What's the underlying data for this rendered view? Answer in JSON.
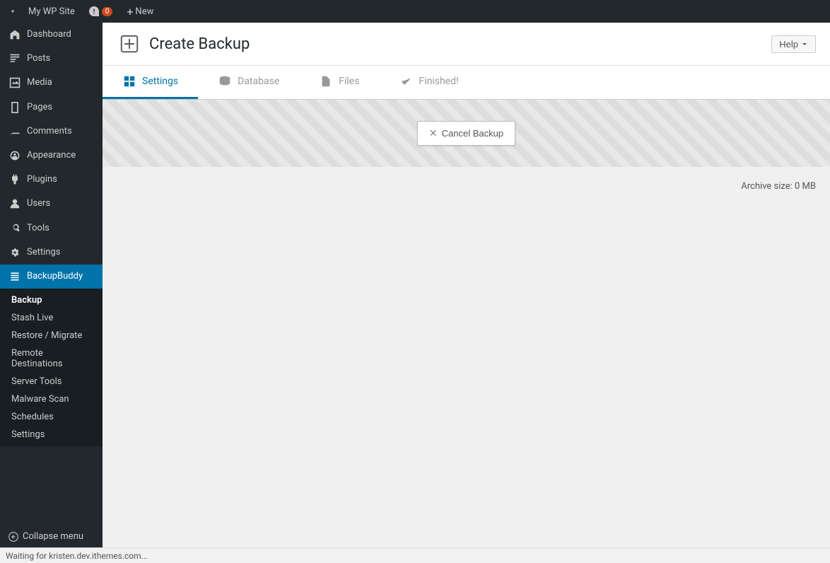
{
  "adminbar": {
    "site_name": "My WP Site",
    "comment_count": "0",
    "new_label": "New"
  },
  "sidebar": {
    "items": [
      {
        "id": "dashboard",
        "label": "Dashboard",
        "icon": "dashboard"
      },
      {
        "id": "posts",
        "label": "Posts",
        "icon": "posts"
      },
      {
        "id": "media",
        "label": "Media",
        "icon": "media"
      },
      {
        "id": "pages",
        "label": "Pages",
        "icon": "pages"
      },
      {
        "id": "comments",
        "label": "Comments",
        "icon": "comments"
      },
      {
        "id": "appearance",
        "label": "Appearance",
        "icon": "appearance"
      },
      {
        "id": "plugins",
        "label": "Plugins",
        "icon": "plugins"
      },
      {
        "id": "users",
        "label": "Users",
        "icon": "users"
      },
      {
        "id": "tools",
        "label": "Tools",
        "icon": "tools"
      },
      {
        "id": "settings",
        "label": "Settings",
        "icon": "settings"
      },
      {
        "id": "backupbuddy",
        "label": "BackupBuddy",
        "icon": "backupbuddy"
      }
    ],
    "backupbuddy_submenu": [
      {
        "id": "backup",
        "label": "Backup",
        "active": true
      },
      {
        "id": "stash-live",
        "label": "Stash Live"
      },
      {
        "id": "restore-migrate",
        "label": "Restore / Migrate"
      },
      {
        "id": "remote-destinations",
        "label": "Remote Destinations"
      },
      {
        "id": "server-tools",
        "label": "Server Tools"
      },
      {
        "id": "malware-scan",
        "label": "Malware Scan"
      },
      {
        "id": "schedules",
        "label": "Schedules"
      },
      {
        "id": "settings-bb",
        "label": "Settings"
      }
    ],
    "collapse_label": "Collapse menu"
  },
  "page": {
    "title": "Create Backup",
    "help_label": "Help"
  },
  "tabs": [
    {
      "id": "settings",
      "label": "Settings",
      "active": true
    },
    {
      "id": "database",
      "label": "Database",
      "active": false
    },
    {
      "id": "files",
      "label": "Files",
      "active": false
    },
    {
      "id": "finished",
      "label": "Finished!",
      "active": false
    }
  ],
  "content": {
    "cancel_backup_label": "Cancel Backup",
    "archive_size_label": "Archive size:",
    "archive_size_value": "0 MB"
  },
  "statusbar": {
    "text": "Waiting for kristen.dev.ithemes.com..."
  }
}
